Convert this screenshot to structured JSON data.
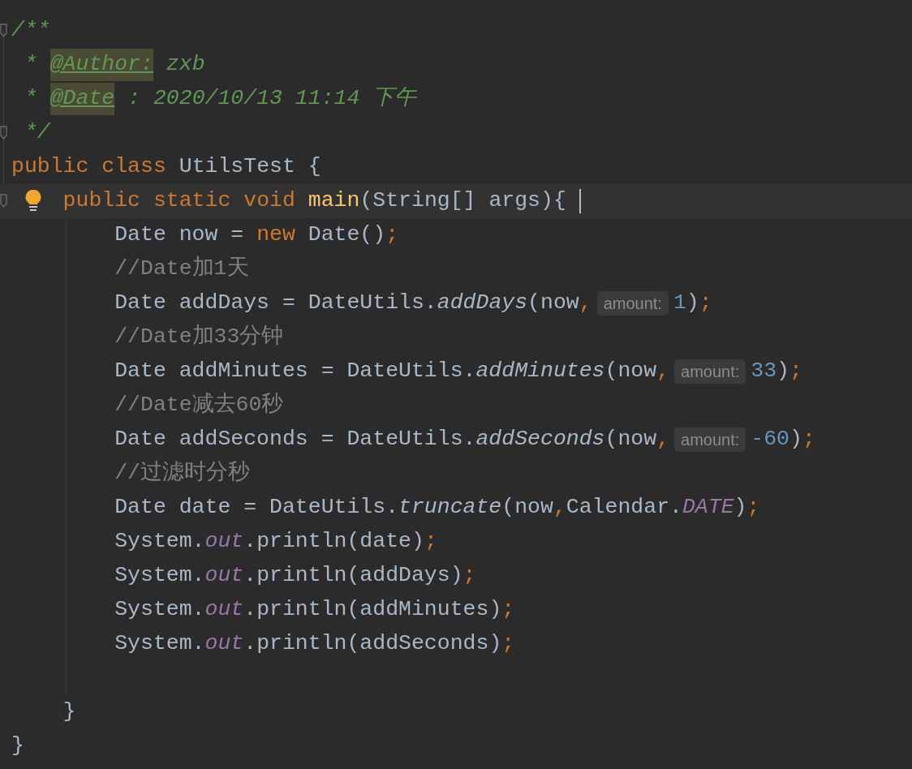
{
  "lines": [
    {
      "fold_marker": true,
      "tokens": [
        {
          "kind": "doc",
          "text": "/**"
        }
      ]
    },
    {
      "tokens": [
        {
          "kind": "doc",
          "text": " * "
        },
        {
          "kind": "doc-tag",
          "text": "@Author:"
        },
        {
          "kind": "doc",
          "text": " zxb"
        }
      ]
    },
    {
      "tokens": [
        {
          "kind": "doc",
          "text": " * "
        },
        {
          "kind": "doc-tag",
          "text": "@Date"
        },
        {
          "kind": "doc",
          "text": " : 2020/10/13 11:14 下午"
        }
      ]
    },
    {
      "fold_marker": true,
      "tokens": [
        {
          "kind": "doc",
          "text": " */"
        }
      ]
    },
    {
      "tokens": [
        {
          "kind": "keyword",
          "text": "public class "
        },
        {
          "kind": "plain",
          "text": "UtilsTest {"
        }
      ],
      "children": [
        {
          "fold_marker": true,
          "current": true,
          "bulb": true,
          "caret": true,
          "tokens": [
            {
              "kind": "keyword",
              "text": "public static void "
            },
            {
              "kind": "method",
              "text": "main"
            },
            {
              "kind": "plain",
              "text": "(String[] args){ "
            }
          ],
          "children": [
            {
              "tokens": [
                {
                  "kind": "plain",
                  "text": "Date now = "
                },
                {
                  "kind": "keyword",
                  "text": "new"
                },
                {
                  "kind": "plain",
                  "text": " Date()"
                },
                {
                  "kind": "punct",
                  "text": ";"
                }
              ]
            },
            {
              "tokens": [
                {
                  "kind": "comment",
                  "text": "//Date加1天"
                }
              ]
            },
            {
              "tokens": [
                {
                  "kind": "plain",
                  "text": "Date addDays = DateUtils."
                },
                {
                  "kind": "call",
                  "text": "addDays"
                },
                {
                  "kind": "plain",
                  "text": "(now"
                },
                {
                  "kind": "punct",
                  "text": ","
                },
                {
                  "kind": "hint",
                  "text": "amount:"
                },
                {
                  "kind": "number",
                  "text": "1"
                },
                {
                  "kind": "plain",
                  "text": ")"
                },
                {
                  "kind": "punct",
                  "text": ";"
                }
              ]
            },
            {
              "tokens": [
                {
                  "kind": "comment",
                  "text": "//Date加33分钟"
                }
              ]
            },
            {
              "tokens": [
                {
                  "kind": "plain",
                  "text": "Date addMinutes = DateUtils."
                },
                {
                  "kind": "call",
                  "text": "addMinutes"
                },
                {
                  "kind": "plain",
                  "text": "(now"
                },
                {
                  "kind": "punct",
                  "text": ","
                },
                {
                  "kind": "hint",
                  "text": "amount:"
                },
                {
                  "kind": "number",
                  "text": "33"
                },
                {
                  "kind": "plain",
                  "text": ")"
                },
                {
                  "kind": "punct",
                  "text": ";"
                }
              ]
            },
            {
              "tokens": [
                {
                  "kind": "comment",
                  "text": "//Date减去60秒"
                }
              ]
            },
            {
              "tokens": [
                {
                  "kind": "plain",
                  "text": "Date addSeconds = DateUtils."
                },
                {
                  "kind": "call",
                  "text": "addSeconds"
                },
                {
                  "kind": "plain",
                  "text": "(now"
                },
                {
                  "kind": "punct",
                  "text": ","
                },
                {
                  "kind": "hint",
                  "text": "amount:"
                },
                {
                  "kind": "number",
                  "text": "-60"
                },
                {
                  "kind": "plain",
                  "text": ")"
                },
                {
                  "kind": "punct",
                  "text": ";"
                }
              ]
            },
            {
              "tokens": [
                {
                  "kind": "comment",
                  "text": "//过滤时分秒"
                }
              ]
            },
            {
              "tokens": [
                {
                  "kind": "plain",
                  "text": "Date date = DateUtils."
                },
                {
                  "kind": "call",
                  "text": "truncate"
                },
                {
                  "kind": "plain",
                  "text": "(now"
                },
                {
                  "kind": "punct",
                  "text": ","
                },
                {
                  "kind": "plain",
                  "text": "Calendar."
                },
                {
                  "kind": "field",
                  "text": "DATE"
                },
                {
                  "kind": "plain",
                  "text": ")"
                },
                {
                  "kind": "punct",
                  "text": ";"
                }
              ]
            },
            {
              "tokens": [
                {
                  "kind": "plain",
                  "text": "System."
                },
                {
                  "kind": "field",
                  "text": "out"
                },
                {
                  "kind": "plain",
                  "text": ".println(date)"
                },
                {
                  "kind": "punct",
                  "text": ";"
                }
              ]
            },
            {
              "tokens": [
                {
                  "kind": "plain",
                  "text": "System."
                },
                {
                  "kind": "field",
                  "text": "out"
                },
                {
                  "kind": "plain",
                  "text": ".println(addDays)"
                },
                {
                  "kind": "punct",
                  "text": ";"
                }
              ]
            },
            {
              "tokens": [
                {
                  "kind": "plain",
                  "text": "System."
                },
                {
                  "kind": "field",
                  "text": "out"
                },
                {
                  "kind": "plain",
                  "text": ".println(addMinutes)"
                },
                {
                  "kind": "punct",
                  "text": ";"
                }
              ]
            },
            {
              "tokens": [
                {
                  "kind": "plain",
                  "text": "System."
                },
                {
                  "kind": "field",
                  "text": "out"
                },
                {
                  "kind": "plain",
                  "text": ".println(addSeconds)"
                },
                {
                  "kind": "punct",
                  "text": ";"
                }
              ]
            }
          ]
        },
        {
          "tokens": [
            {
              "kind": "plain",
              "text": "}"
            }
          ]
        }
      ]
    },
    {
      "tokens": [
        {
          "kind": "plain",
          "text": "}"
        }
      ]
    }
  ]
}
